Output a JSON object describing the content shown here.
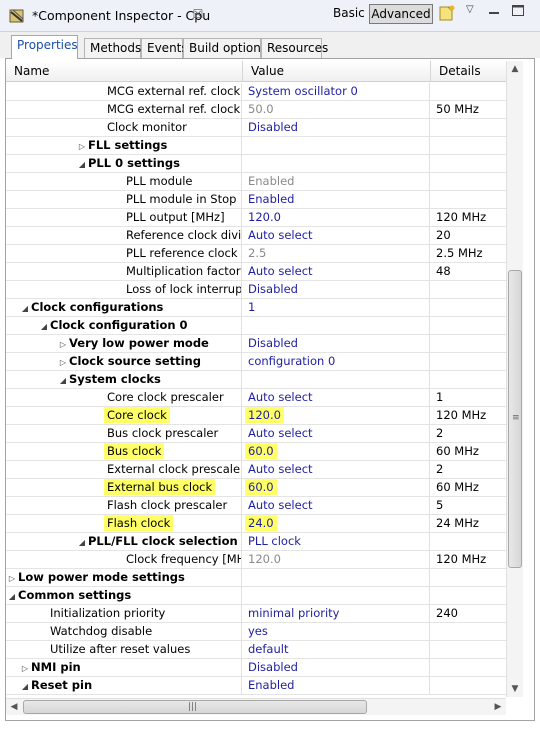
{
  "window": {
    "title": "*Component Inspector - Cpu",
    "close_glyph": "☒",
    "mode_basic": "Basic",
    "mode_advanced": "Advanced",
    "menu_glyph": "▽"
  },
  "tabs": [
    {
      "label": "Properties",
      "active": true
    },
    {
      "label": "Methods",
      "active": false
    },
    {
      "label": "Events",
      "active": false
    },
    {
      "label": "Build options",
      "active": false
    },
    {
      "label": "Resources",
      "active": false
    }
  ],
  "columns": {
    "name": "Name",
    "value": "Value",
    "details": "Details"
  },
  "rows": [
    {
      "name": "MCG external ref. clock s",
      "value": "System oscillator 0",
      "details": "",
      "indent": 5,
      "twisty": "",
      "bold": false,
      "gray": false,
      "hl": false
    },
    {
      "name": "MCG external ref. clock [",
      "value": "50.0",
      "details": "50 MHz",
      "indent": 5,
      "twisty": "",
      "bold": false,
      "gray": true,
      "hl": false
    },
    {
      "name": "Clock monitor",
      "value": "Disabled",
      "details": "",
      "indent": 5,
      "twisty": "",
      "bold": false,
      "gray": false,
      "hl": false
    },
    {
      "name": "FLL settings",
      "value": "",
      "details": "",
      "indent": 4,
      "twisty": "▷",
      "bold": true,
      "gray": false,
      "hl": false
    },
    {
      "name": "PLL 0 settings",
      "value": "",
      "details": "",
      "indent": 4,
      "twisty": "◢",
      "bold": true,
      "gray": false,
      "hl": false
    },
    {
      "name": "PLL module",
      "value": "Enabled",
      "details": "",
      "indent": 6,
      "twisty": "",
      "bold": false,
      "gray": true,
      "hl": false
    },
    {
      "name": "PLL module in Stop",
      "value": "Enabled",
      "details": "",
      "indent": 6,
      "twisty": "",
      "bold": false,
      "gray": false,
      "hl": false
    },
    {
      "name": "PLL output [MHz]",
      "value": "120.0",
      "details": "120 MHz",
      "indent": 6,
      "twisty": "",
      "bold": false,
      "gray": false,
      "hl": false
    },
    {
      "name": "Reference clock divic",
      "value": "Auto select",
      "details": "20",
      "indent": 6,
      "twisty": "",
      "bold": false,
      "gray": false,
      "hl": false
    },
    {
      "name": "PLL reference clock [",
      "value": "2.5",
      "details": "2.5 MHz",
      "indent": 6,
      "twisty": "",
      "bold": false,
      "gray": true,
      "hl": false
    },
    {
      "name": "Multiplication factor",
      "value": "Auto select",
      "details": "48",
      "indent": 6,
      "twisty": "",
      "bold": false,
      "gray": false,
      "hl": false
    },
    {
      "name": "Loss of lock interrupt",
      "value": "Disabled",
      "details": "",
      "indent": 6,
      "twisty": "",
      "bold": false,
      "gray": false,
      "hl": false
    },
    {
      "name": "Clock configurations",
      "value": "1",
      "details": "",
      "indent": 1,
      "twisty": "◢",
      "bold": true,
      "gray": false,
      "hl": false
    },
    {
      "name": "Clock configuration 0",
      "value": "",
      "details": "",
      "indent": 2,
      "twisty": "◢",
      "bold": true,
      "gray": false,
      "hl": false
    },
    {
      "name": "Very low power mode",
      "value": "Disabled",
      "details": "",
      "indent": 3,
      "twisty": "▷",
      "bold": true,
      "gray": false,
      "hl": false
    },
    {
      "name": "Clock source setting",
      "value": "configuration 0",
      "details": "",
      "indent": 3,
      "twisty": "▷",
      "bold": true,
      "gray": false,
      "hl": false
    },
    {
      "name": "System clocks",
      "value": "",
      "details": "",
      "indent": 3,
      "twisty": "◢",
      "bold": true,
      "gray": false,
      "hl": false
    },
    {
      "name": "Core clock prescaler",
      "value": "Auto select",
      "details": "1",
      "indent": 5,
      "twisty": "",
      "bold": false,
      "gray": false,
      "hl": false
    },
    {
      "name": "Core clock",
      "value": "120.0",
      "details": "120 MHz",
      "indent": 5,
      "twisty": "",
      "bold": false,
      "gray": false,
      "hl": true
    },
    {
      "name": "Bus clock prescaler",
      "value": "Auto select",
      "details": "2",
      "indent": 5,
      "twisty": "",
      "bold": false,
      "gray": false,
      "hl": false
    },
    {
      "name": "Bus clock",
      "value": "60.0",
      "details": "60 MHz",
      "indent": 5,
      "twisty": "",
      "bold": false,
      "gray": false,
      "hl": true
    },
    {
      "name": "External clock prescaler",
      "value": "Auto select",
      "details": "2",
      "indent": 5,
      "twisty": "",
      "bold": false,
      "gray": false,
      "hl": false
    },
    {
      "name": "External bus clock",
      "value": "60.0",
      "details": "60 MHz",
      "indent": 5,
      "twisty": "",
      "bold": false,
      "gray": false,
      "hl": true
    },
    {
      "name": "Flash clock prescaler",
      "value": "Auto select",
      "details": "5",
      "indent": 5,
      "twisty": "",
      "bold": false,
      "gray": false,
      "hl": false
    },
    {
      "name": "Flash clock",
      "value": "24.0",
      "details": "24 MHz",
      "indent": 5,
      "twisty": "",
      "bold": false,
      "gray": false,
      "hl": true
    },
    {
      "name": "PLL/FLL clock selection",
      "value": "PLL clock",
      "details": "",
      "indent": 4,
      "twisty": "◢",
      "bold": true,
      "gray": false,
      "hl": false
    },
    {
      "name": "Clock frequency [MH",
      "value": "120.0",
      "details": "120 MHz",
      "indent": 6,
      "twisty": "",
      "bold": false,
      "gray": true,
      "hl": false
    },
    {
      "name": "Low power mode settings",
      "value": "",
      "details": "",
      "indent": 0,
      "twisty": "▷",
      "bold": true,
      "gray": false,
      "hl": false
    },
    {
      "name": "Common settings",
      "value": "",
      "details": "",
      "indent": 0,
      "twisty": "◢",
      "bold": true,
      "gray": false,
      "hl": false
    },
    {
      "name": "Initialization priority",
      "value": "minimal priority",
      "details": "240",
      "indent": 2,
      "twisty": "",
      "bold": false,
      "gray": false,
      "hl": false
    },
    {
      "name": "Watchdog disable",
      "value": "yes",
      "details": "",
      "indent": 2,
      "twisty": "",
      "bold": false,
      "gray": false,
      "hl": false
    },
    {
      "name": "Utilize after reset values",
      "value": "default",
      "details": "",
      "indent": 2,
      "twisty": "",
      "bold": false,
      "gray": false,
      "hl": false
    },
    {
      "name": "NMI pin",
      "value": "Disabled",
      "details": "",
      "indent": 1,
      "twisty": "▷",
      "bold": true,
      "gray": false,
      "hl": false
    },
    {
      "name": "Reset pin",
      "value": "Enabled",
      "details": "",
      "indent": 1,
      "twisty": "◢",
      "bold": true,
      "gray": false,
      "hl": false
    }
  ],
  "colors": {
    "value_text": "#1e1ea0",
    "gray_text": "#8a8a8a",
    "highlight": "#ffff66",
    "active_tab": "#1a4ea8"
  }
}
